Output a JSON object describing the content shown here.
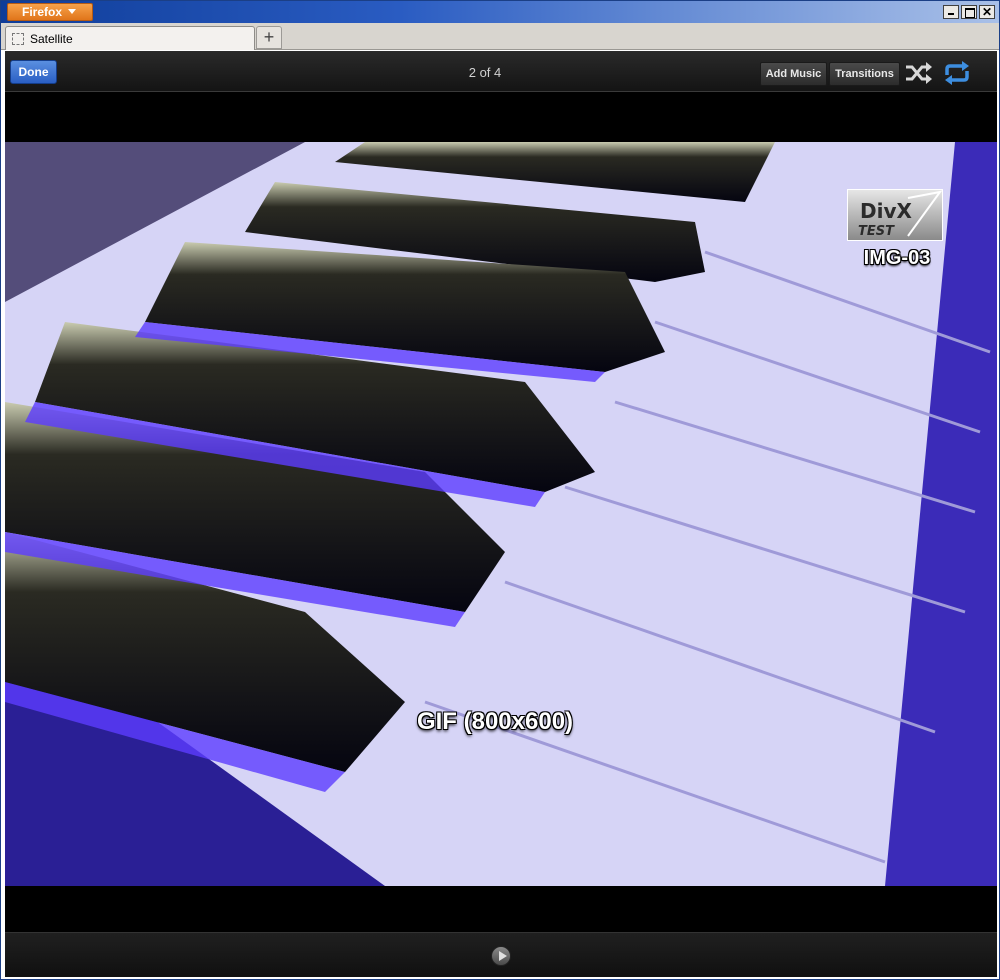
{
  "window": {
    "app_menu_label": "Firefox",
    "controls": {
      "minimize": "minimize-icon",
      "maximize": "maximize-icon",
      "close": "close-icon"
    }
  },
  "tabs": [
    {
      "label": "Satellite",
      "icon": "page-icon"
    }
  ],
  "new_tab_label": "+",
  "viewer": {
    "done_label": "Done",
    "counter": "2 of 4",
    "add_music_label": "Add Music",
    "transitions_label": "Transitions",
    "shuffle_icon": "shuffle-icon",
    "repeat_icon": "repeat-icon",
    "accent_color": "#3d8ee0"
  },
  "photo": {
    "logo_text": "DivX",
    "logo_subtext": "TEST",
    "label": "IMG-03",
    "caption": "GIF (800x600)"
  },
  "bottom": {
    "play_icon": "play-icon"
  }
}
